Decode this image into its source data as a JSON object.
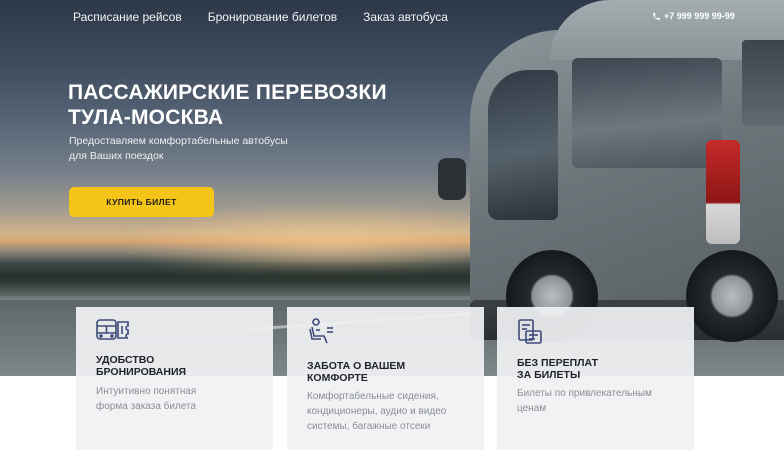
{
  "nav": {
    "items": [
      {
        "label": "Расписание рейсов"
      },
      {
        "label": "Бронирование билетов"
      },
      {
        "label": "Заказ автобуса"
      }
    ],
    "phone": "+7 999 999 99-99"
  },
  "hero": {
    "title": "ПАССАЖИРСКИЕ ПЕРЕВОЗКИ\nТУЛА-МОСКВА",
    "subtitle": "Предоставляем комфортабельные автобусы\nдля Ваших поездок",
    "cta_label": "КУПИТЬ БИЛЕТ"
  },
  "features": [
    {
      "icon": "bus-ticket-icon",
      "title": "УДОБСТВО\nБРОНИРОВАНИЯ",
      "text": "Интуитивно понятная\nформа заказа билета"
    },
    {
      "icon": "passenger-seat-icon",
      "title": "ЗАБОТА О ВАШЕМ\nКОМФОРТЕ",
      "text": "Комфортабельные сидения,\nкондиционеры, аудио и видео\nсистемы, багажные отсеки"
    },
    {
      "icon": "ticket-price-icon",
      "title": "БЕЗ ПЕРЕПЛАТ\nЗА БИЛЕТЫ",
      "text": "Билеты по привлекательным\nценам"
    }
  ],
  "colors": {
    "accent": "#f5c418",
    "icon": "#3d4a7a",
    "card_bg": "#f0f1f3",
    "muted_text": "#8a8e94"
  }
}
